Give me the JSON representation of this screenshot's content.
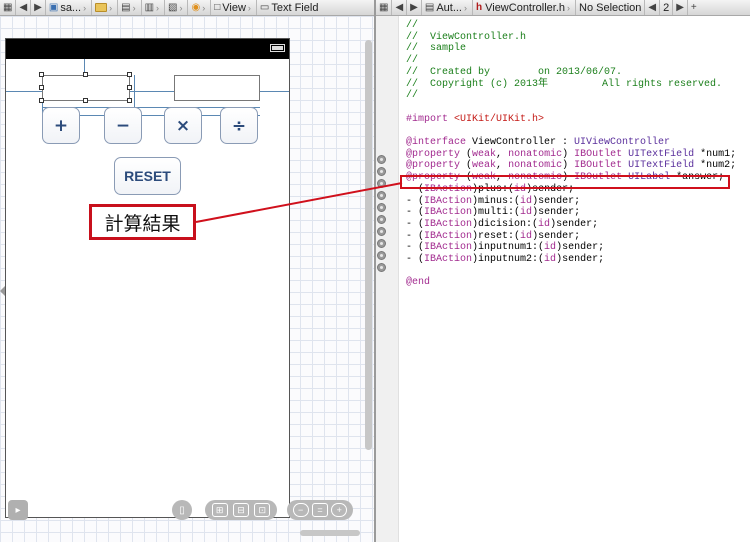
{
  "jumpbar_left": {
    "project": "sa...",
    "item": "View",
    "field": "Text Field"
  },
  "jumpbar_right": {
    "counterparts": "Aut...",
    "file": "ViewController.h",
    "selection": "No Selection",
    "counter": "2"
  },
  "canvas": {
    "op_buttons": [
      "+",
      "−",
      "×",
      "÷"
    ],
    "reset_label": "RESET",
    "callout_label": "計算結果"
  },
  "code": {
    "lines": [
      {
        "text": "//",
        "cls": "cm"
      },
      {
        "text": "//  ViewController.h",
        "cls": "cm"
      },
      {
        "text": "//  sample",
        "cls": "cm"
      },
      {
        "text": "//",
        "cls": "cm"
      },
      {
        "text": "//  Created by        on 2013/06/07.",
        "cls": "cm"
      },
      {
        "text": "//  Copyright (c) 2013年         All rights reserved.",
        "cls": "cm"
      },
      {
        "text": "//",
        "cls": "cm"
      },
      {
        "text": "",
        "cls": ""
      },
      {
        "text": "#import <UIKit/UIKit.h>",
        "cls": "imp"
      },
      {
        "text": "",
        "cls": ""
      },
      {
        "text": "@interface ViewController : UIViewController",
        "cls": "iface"
      },
      {
        "text": "@property (weak, nonatomic) IBOutlet UITextField *num1;",
        "cls": "prop"
      },
      {
        "text": "@property (weak, nonatomic) IBOutlet UITextField *num2;",
        "cls": "prop"
      },
      {
        "text": "@property (weak, nonatomic) IBOutlet UILabel *answer;",
        "cls": "prop"
      },
      {
        "text": "- (IBAction)plus:(id)sender;",
        "cls": "act"
      },
      {
        "text": "- (IBAction)minus:(id)sender;",
        "cls": "act"
      },
      {
        "text": "- (IBAction)multi:(id)sender;",
        "cls": "act"
      },
      {
        "text": "- (IBAction)dicision:(id)sender;",
        "cls": "act"
      },
      {
        "text": "- (IBAction)reset:(id)sender;",
        "cls": "act"
      },
      {
        "text": "- (IBAction)inputnum1:(id)sender;",
        "cls": "act"
      },
      {
        "text": "- (IBAction)inputnum2:(id)sender;",
        "cls": "act"
      },
      {
        "text": "",
        "cls": ""
      },
      {
        "text": "@end",
        "cls": "end"
      }
    ]
  },
  "colors": {
    "annotation_red": "#d0101c",
    "comment_green": "#1b7f1b",
    "keyword_purple": "#a22b8f",
    "string_red": "#c41a16",
    "button_text": "#2c4b7b"
  }
}
